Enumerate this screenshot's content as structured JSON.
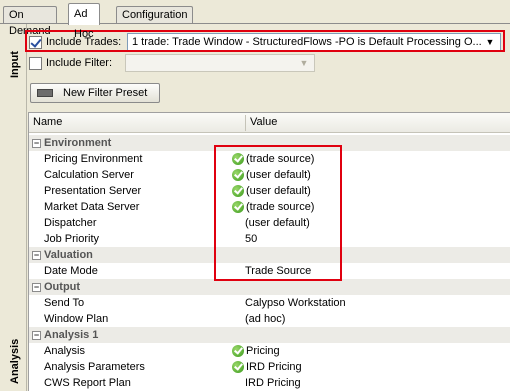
{
  "tabs": [
    "On Demand",
    "Ad Hoc",
    "Configuration"
  ],
  "side_labels": {
    "input": "Input",
    "analysis": "Analysis"
  },
  "include_trades": {
    "label": "Include Trades:",
    "checked": true,
    "value": "1 trade: Trade Window - StructuredFlows  -PO is Default Processing O..."
  },
  "include_filter": {
    "label": "Include Filter:",
    "checked": false,
    "value": ""
  },
  "new_filter_preset_label": "New Filter Preset",
  "table": {
    "headers": {
      "name": "Name",
      "value": "Value"
    },
    "sections": {
      "environment": "Environment",
      "valuation": "Valuation",
      "output": "Output",
      "analysis1": "Analysis 1"
    },
    "rows": {
      "pricing_environment": {
        "name": "Pricing Environment",
        "value": "(trade source)"
      },
      "calculation_server": {
        "name": "Calculation Server",
        "value": "(user default)"
      },
      "presentation_server": {
        "name": "Presentation Server",
        "value": "(user default)"
      },
      "market_data_server": {
        "name": "Market Data Server",
        "value": "(trade source)"
      },
      "dispatcher": {
        "name": "Dispatcher",
        "value": "(user default)"
      },
      "job_priority": {
        "name": "Job Priority",
        "value": "50"
      },
      "date_mode": {
        "name": "Date Mode",
        "value": "Trade Source"
      },
      "send_to": {
        "name": "Send To",
        "value": "Calypso Workstation"
      },
      "window_plan": {
        "name": "Window Plan",
        "value": "(ad hoc)"
      },
      "analysis": {
        "name": "Analysis",
        "value": "Pricing"
      },
      "analysis_parameters": {
        "name": "Analysis Parameters",
        "value": "IRD Pricing"
      },
      "cws_report_plan": {
        "name": "CWS Report Plan",
        "value": "IRD Pricing"
      }
    }
  },
  "colors": {
    "highlight_box": "#e0000f",
    "ok_icon": "#3a9a1c"
  },
  "icons": [
    "checkbox-checked-icon",
    "checkbox-empty-icon",
    "dropdown-arrow-icon",
    "filter-preset-icon",
    "collapse-minus-icon",
    "check-ok-icon"
  ]
}
